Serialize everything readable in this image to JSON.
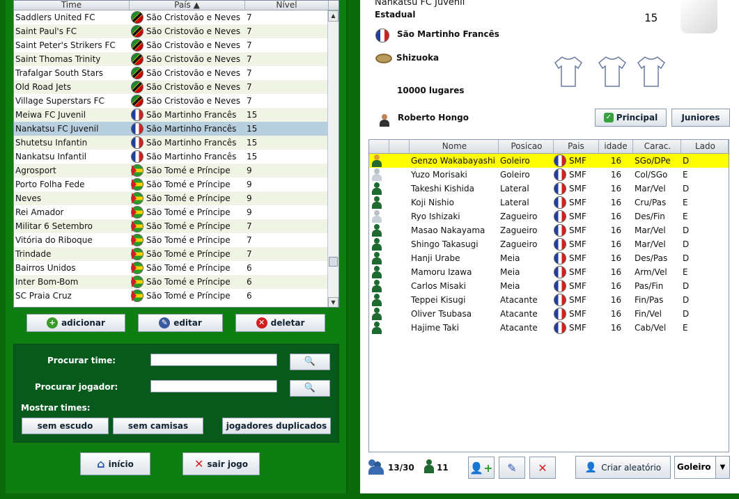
{
  "teams_table": {
    "headers": {
      "name": "Time",
      "country": "País",
      "level": "Nível"
    },
    "rows": [
      {
        "name": "Saddlers United FC",
        "flag": "kn",
        "country": "São Cristovão e Neves",
        "level": "7"
      },
      {
        "name": "Saint Paul's FC",
        "flag": "kn",
        "country": "São Cristovão e Neves",
        "level": "7"
      },
      {
        "name": "Saint Peter's Strikers FC",
        "flag": "kn",
        "country": "São Cristovão e Neves",
        "level": "7"
      },
      {
        "name": "Saint Thomas Trinity",
        "flag": "kn",
        "country": "São Cristovão e Neves",
        "level": "7"
      },
      {
        "name": "Trafalgar South Stars",
        "flag": "kn",
        "country": "São Cristovão e Neves",
        "level": "7"
      },
      {
        "name": "Old Road Jets",
        "flag": "kn",
        "country": "São Cristovão e Neves",
        "level": "7"
      },
      {
        "name": "Village Superstars FC",
        "flag": "kn",
        "country": "São Cristovão e Neves",
        "level": "7"
      },
      {
        "name": "Meiwa FC Juvenil",
        "flag": "fr",
        "country": "São Martinho Francês",
        "level": "15"
      },
      {
        "name": "Nankatsu FC Juvenil",
        "flag": "fr",
        "country": "São Martinho Francês",
        "level": "15"
      },
      {
        "name": "Shutetsu Infantin",
        "flag": "fr",
        "country": "São Martinho Francês",
        "level": "15"
      },
      {
        "name": "Nankatsu Infantil",
        "flag": "fr",
        "country": "São Martinho Francês",
        "level": "15"
      },
      {
        "name": "Agrosport",
        "flag": "st",
        "country": "São Tomé e Príncipe",
        "level": "9"
      },
      {
        "name": "Porto Folha Fede",
        "flag": "st",
        "country": "São Tomé e Príncipe",
        "level": "9"
      },
      {
        "name": "Neves",
        "flag": "st",
        "country": "São Tomé e Príncipe",
        "level": "9"
      },
      {
        "name": "Rei Amador",
        "flag": "st",
        "country": "São Tomé e Príncipe",
        "level": "9"
      },
      {
        "name": "Militar 6 Setembro",
        "flag": "st",
        "country": "São Tomé e Príncipe",
        "level": "7"
      },
      {
        "name": "Vitória do Riboque",
        "flag": "st",
        "country": "São Tomé e Príncipe",
        "level": "7"
      },
      {
        "name": "Trindade",
        "flag": "st",
        "country": "São Tomé e Príncipe",
        "level": "7"
      },
      {
        "name": "Bairros Unidos",
        "flag": "st",
        "country": "São Tomé e Príncipe",
        "level": "6"
      },
      {
        "name": "Inter Bom-Bom",
        "flag": "st",
        "country": "São Tomé e Príncipe",
        "level": "6"
      },
      {
        "name": "SC Praia Cruz",
        "flag": "st",
        "country": "São Tomé e Príncipe",
        "level": "6"
      }
    ],
    "selected_index": 8
  },
  "team_buttons": {
    "add": "adicionar",
    "edit": "editar",
    "delete": "deletar"
  },
  "search": {
    "team_label": "Procurar time:",
    "player_label": "Procurar jogador:",
    "team_value": "",
    "player_value": "",
    "show_label": "Mostrar times:",
    "no_badge": "sem escudo",
    "no_shirts": "sem camisas",
    "duplicates": "jogadores duplicados"
  },
  "nav": {
    "home": "início",
    "exit": "sair jogo"
  },
  "team": {
    "name": "Nankatsu FC Juvenil",
    "type": "Estadual",
    "level": "15",
    "country": "São Martinho Francês",
    "city": "Shizuoka",
    "stadium": "10000 lugares",
    "coach": "Roberto Hongo",
    "btn_main": "Principal",
    "btn_juniors": "Juniores"
  },
  "players_table": {
    "headers": {
      "name": "Nome",
      "position": "Posicao",
      "country": "Pais",
      "age": "idade",
      "traits": "Carac.",
      "side": "Lado"
    },
    "rows": [
      {
        "icon": "sel",
        "name": "Genzo Wakabayashi",
        "position": "Goleiro",
        "country": "SMF",
        "age": "16",
        "traits": "SGo/DPe",
        "side": "D"
      },
      {
        "icon": "gk",
        "name": "Yuzo Morisaki",
        "position": "Goleiro",
        "country": "SMF",
        "age": "16",
        "traits": "Col/SGo",
        "side": "E"
      },
      {
        "icon": "field",
        "name": "Takeshi Kishida",
        "position": "Lateral",
        "country": "SMF",
        "age": "16",
        "traits": "Mar/Vel",
        "side": "D"
      },
      {
        "icon": "field",
        "name": "Koji Nishio",
        "position": "Lateral",
        "country": "SMF",
        "age": "16",
        "traits": "Cru/Pas",
        "side": "E"
      },
      {
        "icon": "gk",
        "name": "Ryo Ishizaki",
        "position": "Zagueiro",
        "country": "SMF",
        "age": "16",
        "traits": "Des/Fin",
        "side": "E"
      },
      {
        "icon": "field",
        "name": "Masao Nakayama",
        "position": "Zagueiro",
        "country": "SMF",
        "age": "16",
        "traits": "Mar/Vel",
        "side": "D"
      },
      {
        "icon": "field",
        "name": "Shingo Takasugi",
        "position": "Zagueiro",
        "country": "SMF",
        "age": "16",
        "traits": "Mar/Vel",
        "side": "D"
      },
      {
        "icon": "field",
        "name": "Hanji Urabe",
        "position": "Meia",
        "country": "SMF",
        "age": "16",
        "traits": "Des/Pas",
        "side": "D"
      },
      {
        "icon": "field",
        "name": "Mamoru Izawa",
        "position": "Meia",
        "country": "SMF",
        "age": "16",
        "traits": "Arm/Vel",
        "side": "E"
      },
      {
        "icon": "field",
        "name": "Carlos Misaki",
        "position": "Meia",
        "country": "SMF",
        "age": "16",
        "traits": "Pas/Fin",
        "side": "D"
      },
      {
        "icon": "field",
        "name": "Teppei Kisugi",
        "position": "Atacante",
        "country": "SMF",
        "age": "16",
        "traits": "Fin/Pas",
        "side": "D"
      },
      {
        "icon": "field",
        "name": "Oliver Tsubasa",
        "position": "Atacante",
        "country": "SMF",
        "age": "16",
        "traits": "Fin/Vel",
        "side": "D"
      },
      {
        "icon": "field",
        "name": "Hajime Taki",
        "position": "Atacante",
        "country": "SMF",
        "age": "16",
        "traits": "Cab/Vel",
        "side": "E"
      }
    ]
  },
  "footer": {
    "squad_count": "13/30",
    "player_count": "11",
    "random_label": "Criar aleatório",
    "position_select": "Goleiro"
  },
  "colors": {
    "highlight_row": "#ffff00",
    "selected_row": "#b8cfe0",
    "green_bg": "#0b7a10"
  }
}
